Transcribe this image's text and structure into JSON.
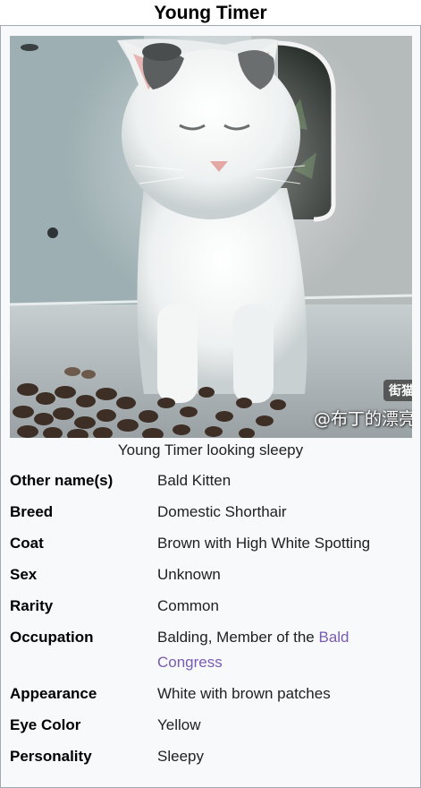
{
  "title": "Young Timer",
  "image": {
    "caption": "Young Timer looking sleepy",
    "watermark_badge": "街猫",
    "watermark_text": "@布丁的漂亮"
  },
  "rows": [
    {
      "label": "Other name(s)",
      "value": "Bald Kitten"
    },
    {
      "label": "Breed",
      "value": "Domestic Shorthair"
    },
    {
      "label": "Coat",
      "value": "Brown with High White Spotting"
    },
    {
      "label": "Sex",
      "value": "Unknown"
    },
    {
      "label": "Rarity",
      "value": "Common"
    },
    {
      "label": "Occupation",
      "value_prefix": "Balding, Member of the ",
      "value_link": "Bald Congress"
    },
    {
      "label": "Appearance",
      "value": "White with brown patches"
    },
    {
      "label": "Eye Color",
      "value": "Yellow"
    },
    {
      "label": "Personality",
      "value": "Sleepy"
    }
  ],
  "colors": {
    "link": "#795cb2",
    "infobox_background": "#f8f9fa",
    "infobox_border": "#a2a9b1"
  }
}
